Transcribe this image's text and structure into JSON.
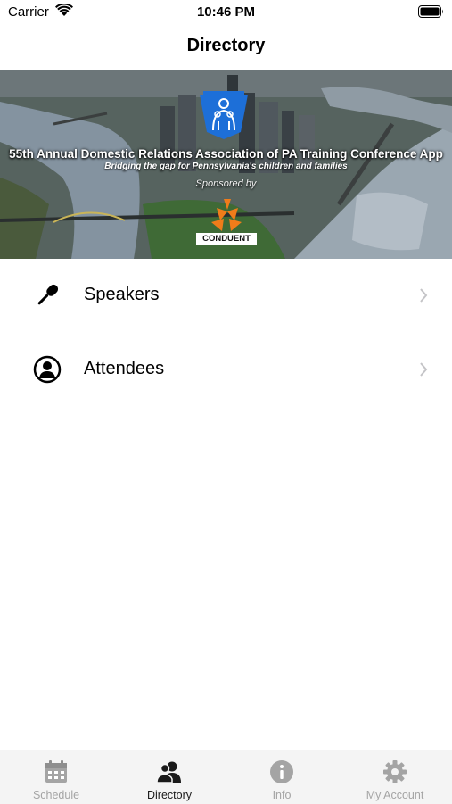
{
  "status_bar": {
    "carrier": "Carrier",
    "time": "10:46 PM"
  },
  "nav": {
    "title": "Directory"
  },
  "banner": {
    "title": "55th Annual Domestic Relations Association of PA Training Conference App",
    "subtitle": "Bridging the gap for Pennsylvania's children and families",
    "sponsored_by": "Sponsored by",
    "sponsor_name": "CONDUENT"
  },
  "list": {
    "items": [
      {
        "label": "Speakers",
        "icon": "microphone-icon"
      },
      {
        "label": "Attendees",
        "icon": "person-icon"
      }
    ]
  },
  "tab_bar": {
    "active": "Directory",
    "tabs": [
      {
        "label": "Schedule",
        "icon": "calendar-icon"
      },
      {
        "label": "Directory",
        "icon": "people-icon"
      },
      {
        "label": "Info",
        "icon": "info-icon"
      },
      {
        "label": "My Account",
        "icon": "gear-icon"
      }
    ]
  },
  "colors": {
    "tab_active": "#1a1a1a",
    "tab_inactive": "#a4a4a4",
    "logo_blue": "#1d6fd8",
    "sponsor_orange": "#f07c1a"
  }
}
